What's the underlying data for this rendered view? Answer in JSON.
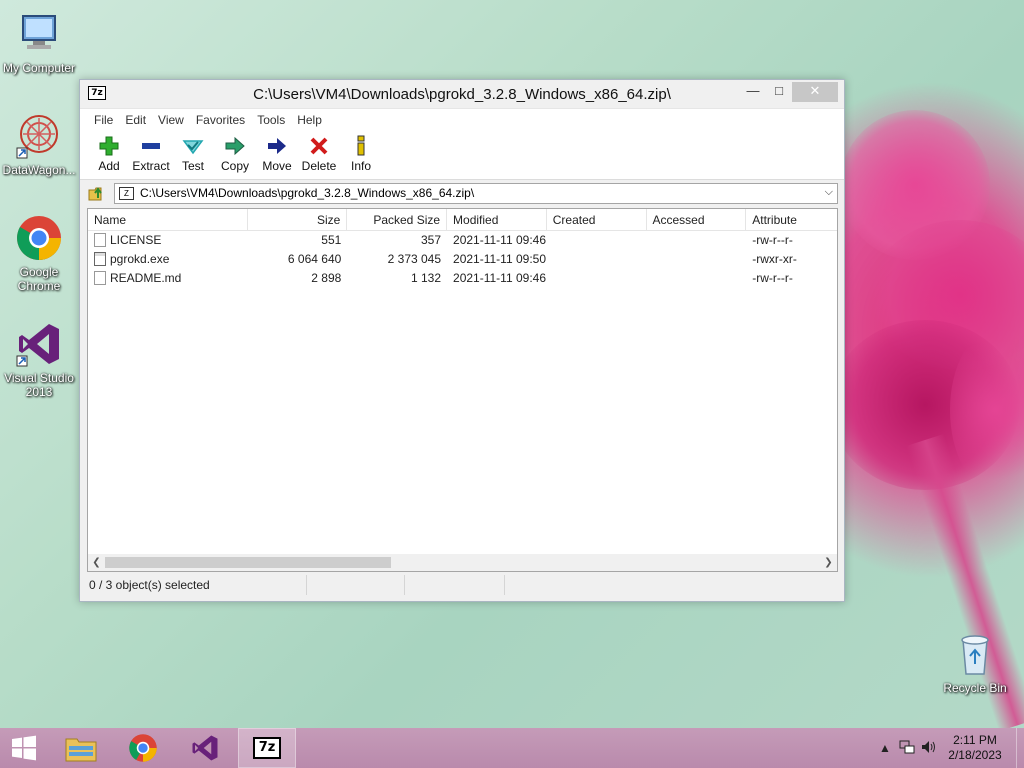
{
  "desktop": {
    "icons": [
      {
        "label": "My Computer",
        "icon": "computer-icon"
      },
      {
        "label": "DataWagon...",
        "icon": "datawagon-icon"
      },
      {
        "label": "Google Chrome",
        "icon": "chrome-icon"
      },
      {
        "label": "Visual Studio 2013",
        "icon": "visual-studio-icon"
      },
      {
        "label": "Recycle Bin",
        "icon": "recycle-bin-icon"
      }
    ]
  },
  "window": {
    "app_icon_text": "7z",
    "title": "C:\\Users\\VM4\\Downloads\\pgrokd_3.2.8_Windows_x86_64.zip\\",
    "controls": {
      "minimize": "—",
      "maximize": "□",
      "close": "✕"
    }
  },
  "menu": [
    "File",
    "Edit",
    "View",
    "Favorites",
    "Tools",
    "Help"
  ],
  "toolbar": [
    {
      "label": "Add",
      "icon": "add-icon",
      "color": "#2fae2f"
    },
    {
      "label": "Extract",
      "icon": "extract-icon",
      "color": "#1f3f9f"
    },
    {
      "label": "Test",
      "icon": "test-icon",
      "color": "#23a7b0"
    },
    {
      "label": "Copy",
      "icon": "copy-icon",
      "color": "#2a9e6a"
    },
    {
      "label": "Move",
      "icon": "move-icon",
      "color": "#1c2a8a"
    },
    {
      "label": "Delete",
      "icon": "delete-icon",
      "color": "#d11b1b"
    },
    {
      "label": "Info",
      "icon": "info-icon",
      "color": "#e0c000"
    }
  ],
  "address": {
    "path": "C:\\Users\\VM4\\Downloads\\pgrokd_3.2.8_Windows_x86_64.zip\\"
  },
  "columns": {
    "name": "Name",
    "size": "Size",
    "packed": "Packed Size",
    "modified": "Modified",
    "created": "Created",
    "accessed": "Accessed",
    "attributes": "Attribute"
  },
  "files": [
    {
      "name": "LICENSE",
      "size": "551",
      "packed": "357",
      "modified": "2021-11-11 09:46",
      "created": "",
      "accessed": "",
      "attributes": "-rw-r--r-"
    },
    {
      "name": "pgrokd.exe",
      "size": "6 064 640",
      "packed": "2 373 045",
      "modified": "2021-11-11 09:50",
      "created": "",
      "accessed": "",
      "attributes": "-rwxr-xr-"
    },
    {
      "name": "README.md",
      "size": "2 898",
      "packed": "1 132",
      "modified": "2021-11-11 09:46",
      "created": "",
      "accessed": "",
      "attributes": "-rw-r--r-"
    }
  ],
  "status": {
    "selection": "0 / 3 object(s) selected"
  },
  "taskbar": {
    "time": "2:11 PM",
    "date": "2/18/2023",
    "active_app_text": "7z"
  }
}
